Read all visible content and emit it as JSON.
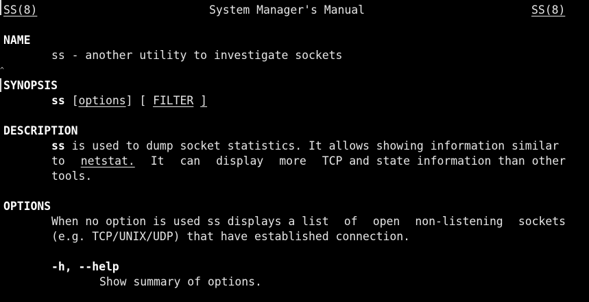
{
  "header": {
    "left": "SS(8)",
    "center": "System Manager's Manual",
    "right": "SS(8)"
  },
  "name": {
    "heading": "NAME",
    "text": "ss - another utility to investigate sockets"
  },
  "synopsis": {
    "heading": "SYNOPSIS",
    "command": "ss",
    "open_bracket": "[",
    "options": "options",
    "middle": "] [",
    "filter": "FILTER",
    "close_bracket": "]"
  },
  "description": {
    "heading": "DESCRIPTION",
    "line1_cmd": "ss",
    "line1_rest": "is used to dump socket statistics. It allows showing information similar",
    "line2_words": [
      "to",
      "netstat.",
      "It",
      "can",
      "display",
      "more",
      "TCP and state information than other"
    ],
    "line3": "tools."
  },
  "options": {
    "heading": "OPTIONS",
    "line1_words": [
      "When no option is used ss displays a list",
      "of",
      "open",
      "non-listening",
      "sockets"
    ],
    "line2": "(e.g. TCP/UNIX/UDP) that have established connection.",
    "items": [
      {
        "flag": "-h, --help",
        "desc": "Show summary of options."
      }
    ]
  }
}
